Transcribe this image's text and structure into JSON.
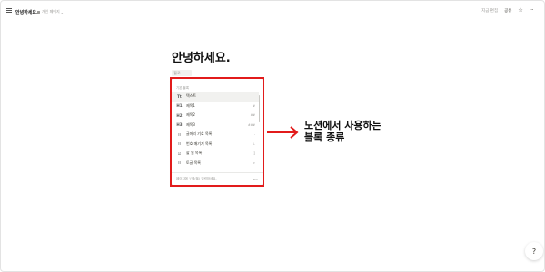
{
  "topbar": {
    "page_title": "안녕하세요.",
    "privacy_label": "개인 페이지",
    "edited_label": "지금 편집",
    "share_label": "공유"
  },
  "page": {
    "heading": "안녕하세요.",
    "command_input": "/블로"
  },
  "popup": {
    "section_label": "기본 블록",
    "items": [
      {
        "icon": "Tt",
        "icon_name": "text-icon",
        "label": "텍스트",
        "shortcut": ""
      },
      {
        "icon": "H1",
        "icon_name": "heading1-icon",
        "label": "제목1",
        "shortcut": "#"
      },
      {
        "icon": "H2",
        "icon_name": "heading2-icon",
        "label": "제목2",
        "shortcut": "##"
      },
      {
        "icon": "H3",
        "icon_name": "heading3-icon",
        "label": "제목3",
        "shortcut": "###"
      },
      {
        "icon": "☷",
        "icon_name": "bulleted-list-icon",
        "label": "글머리 기호 목록",
        "shortcut": "-"
      },
      {
        "icon": "☷",
        "icon_name": "numbered-list-icon",
        "label": "번호 매기기 목록",
        "shortcut": "1."
      },
      {
        "icon": "☑",
        "icon_name": "todo-list-icon",
        "label": "할 일 목록",
        "shortcut": "[]"
      },
      {
        "icon": "☷",
        "icon_name": "toggle-list-icon",
        "label": "토글 목록",
        "shortcut": ">"
      }
    ],
    "footer_text": "페이지에 '/'를(을) 입력하세요.",
    "footer_key": "esc"
  },
  "annotation": {
    "line1": "노션에서 사용하는",
    "line2": "블록 종류"
  },
  "help": {
    "label": "?"
  },
  "colors": {
    "highlight_box": "#e21b1b",
    "text": "#37352f",
    "muted": "#9b9a97"
  }
}
